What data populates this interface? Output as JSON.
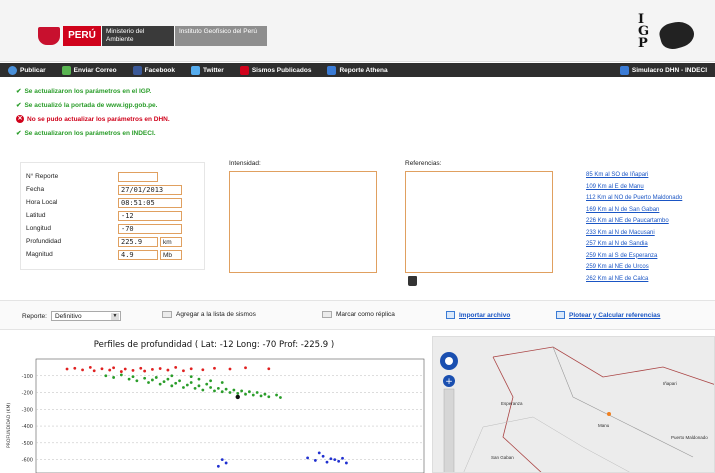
{
  "header": {
    "peru_label": "PERÚ",
    "ministry_label": "Ministerio del Ambiente",
    "institute_label": "Instituto Geofísico del Perú",
    "igp_letters": [
      "I",
      "G",
      "P"
    ]
  },
  "toolbar": {
    "items": [
      {
        "label": "Publicar",
        "icon": "globe-icon",
        "color": "#4a90d9"
      },
      {
        "label": "Enviar Correo",
        "icon": "mail-icon",
        "color": "#5ab552"
      },
      {
        "label": "Facebook",
        "icon": "facebook-icon",
        "color": "#3b5998"
      },
      {
        "label": "Twitter",
        "icon": "twitter-icon",
        "color": "#55acee"
      },
      {
        "label": "Sismos Publicados",
        "icon": "list-icon",
        "color": "#d0021b"
      },
      {
        "label": "Reporte Athena",
        "icon": "report-icon",
        "color": "#3a7bd5"
      }
    ],
    "right_item": {
      "label": "Simulacro DHN - INDECI",
      "icon": "drill-icon",
      "color": "#3a7bd5"
    }
  },
  "messages": [
    {
      "text": "Se actualizaron los parámetros en el IGP.",
      "status": "ok"
    },
    {
      "text": "Se actualizó la portada de www.igp.gob.pe.",
      "status": "ok"
    },
    {
      "text": "No se pudo actualizar los parámetros en DHN.",
      "status": "error"
    },
    {
      "text": "Se actualizaron los parámetros en INDECI.",
      "status": "ok"
    }
  ],
  "form": {
    "reporte": {
      "label": "N° Reporte",
      "value": ""
    },
    "fecha": {
      "label": "Fecha",
      "value": "27/01/2013"
    },
    "hora": {
      "label": "Hora Local",
      "value": "08:51:05"
    },
    "latitud": {
      "label": "Latitud",
      "value": "-12"
    },
    "longitud": {
      "label": "Longitud",
      "value": "-70"
    },
    "profundidad": {
      "label": "Profundidad",
      "value": "225.9",
      "unit": "km"
    },
    "magnitud": {
      "label": "Magnitud",
      "value": "4.9",
      "unit": "Mb"
    }
  },
  "intensidad": {
    "label": "Intensidad:",
    "value": ""
  },
  "referencias": {
    "label": "Referencias:",
    "value": ""
  },
  "reference_links": [
    "85 Km al SO de Iñapari",
    "109 Km al E de Manu",
    "112 Km al NO de Puerto Maldonado",
    "169 Km al N de San Gaban",
    "226 Km al NE de Paucartambo",
    "233 Km al N de Macusani",
    "257 Km al N de Sandia",
    "259 Km al S de Esperanza",
    "259 Km al NE de Urcos",
    "262 Km al NE de Calca"
  ],
  "options": {
    "reporte_label": "Reporte:",
    "reporte_value": "Definitivo",
    "agregar_label": "Agregar a la lista de sismos",
    "replica_label": "Marcar como réplica",
    "importar_label": "Importar archivo",
    "plotear_label": "Plotear y Calcular referencias"
  },
  "chart_data": {
    "type": "scatter",
    "title": "Perfiles de profundidad  ( Lat: -12   Long: -70   Prof: -225.9 )",
    "ylabel": "PROFUNDIDAD (KM)",
    "yticks": [
      -100,
      -200,
      -300,
      -400,
      -500,
      -600
    ],
    "ylim": [
      -680,
      0
    ],
    "xlim": [
      0,
      100
    ],
    "series": [
      {
        "color": "#e02020",
        "points": [
          [
            8,
            -60
          ],
          [
            10,
            -55
          ],
          [
            12,
            -65
          ],
          [
            14,
            -50
          ],
          [
            15,
            -70
          ],
          [
            17,
            -58
          ],
          [
            19,
            -66
          ],
          [
            20,
            -52
          ],
          [
            22,
            -75
          ],
          [
            23,
            -60
          ],
          [
            25,
            -68
          ],
          [
            27,
            -55
          ],
          [
            28,
            -72
          ],
          [
            30,
            -62
          ],
          [
            32,
            -57
          ],
          [
            34,
            -66
          ],
          [
            36,
            -50
          ],
          [
            38,
            -70
          ],
          [
            40,
            -58
          ],
          [
            43,
            -64
          ],
          [
            46,
            -55
          ],
          [
            50,
            -60
          ],
          [
            54,
            -52
          ],
          [
            60,
            -58
          ]
        ]
      },
      {
        "color": "#2a9d2a",
        "points": [
          [
            18,
            -100
          ],
          [
            20,
            -110
          ],
          [
            22,
            -95
          ],
          [
            24,
            -120
          ],
          [
            25,
            -105
          ],
          [
            26,
            -130
          ],
          [
            28,
            -115
          ],
          [
            29,
            -140
          ],
          [
            30,
            -125
          ],
          [
            31,
            -110
          ],
          [
            32,
            -150
          ],
          [
            33,
            -135
          ],
          [
            34,
            -120
          ],
          [
            35,
            -160
          ],
          [
            36,
            -145
          ],
          [
            37,
            -130
          ],
          [
            38,
            -170
          ],
          [
            39,
            -155
          ],
          [
            40,
            -140
          ],
          [
            41,
            -175
          ],
          [
            42,
            -160
          ],
          [
            43,
            -185
          ],
          [
            44,
            -150
          ],
          [
            45,
            -170
          ],
          [
            46,
            -190
          ],
          [
            47,
            -175
          ],
          [
            48,
            -195
          ],
          [
            49,
            -180
          ],
          [
            50,
            -200
          ],
          [
            51,
            -185
          ],
          [
            52,
            -205
          ],
          [
            53,
            -190
          ],
          [
            54,
            -210
          ],
          [
            55,
            -195
          ],
          [
            56,
            -215
          ],
          [
            57,
            -200
          ],
          [
            58,
            -220
          ],
          [
            59,
            -210
          ],
          [
            60,
            -225
          ],
          [
            62,
            -215
          ],
          [
            63,
            -230
          ],
          [
            35,
            -100
          ],
          [
            42,
            -120
          ],
          [
            48,
            -140
          ],
          [
            40,
            -105
          ],
          [
            45,
            -130
          ]
        ]
      },
      {
        "color": "#111111",
        "points": [
          [
            52,
            -226
          ]
        ]
      },
      {
        "color": "#2030d0",
        "points": [
          [
            48,
            -600
          ],
          [
            49,
            -620
          ],
          [
            47,
            -640
          ],
          [
            70,
            -590
          ],
          [
            72,
            -605
          ],
          [
            74,
            -580
          ],
          [
            75,
            -615
          ],
          [
            76,
            -595
          ],
          [
            77,
            -600
          ],
          [
            78,
            -610
          ],
          [
            79,
            -592
          ],
          [
            80,
            -620
          ],
          [
            73,
            -560
          ]
        ]
      }
    ]
  },
  "map": {
    "labels": [
      "Iñapari",
      "Esperanza",
      "Manu",
      "Puerto Maldonado",
      "San Gaban"
    ]
  }
}
